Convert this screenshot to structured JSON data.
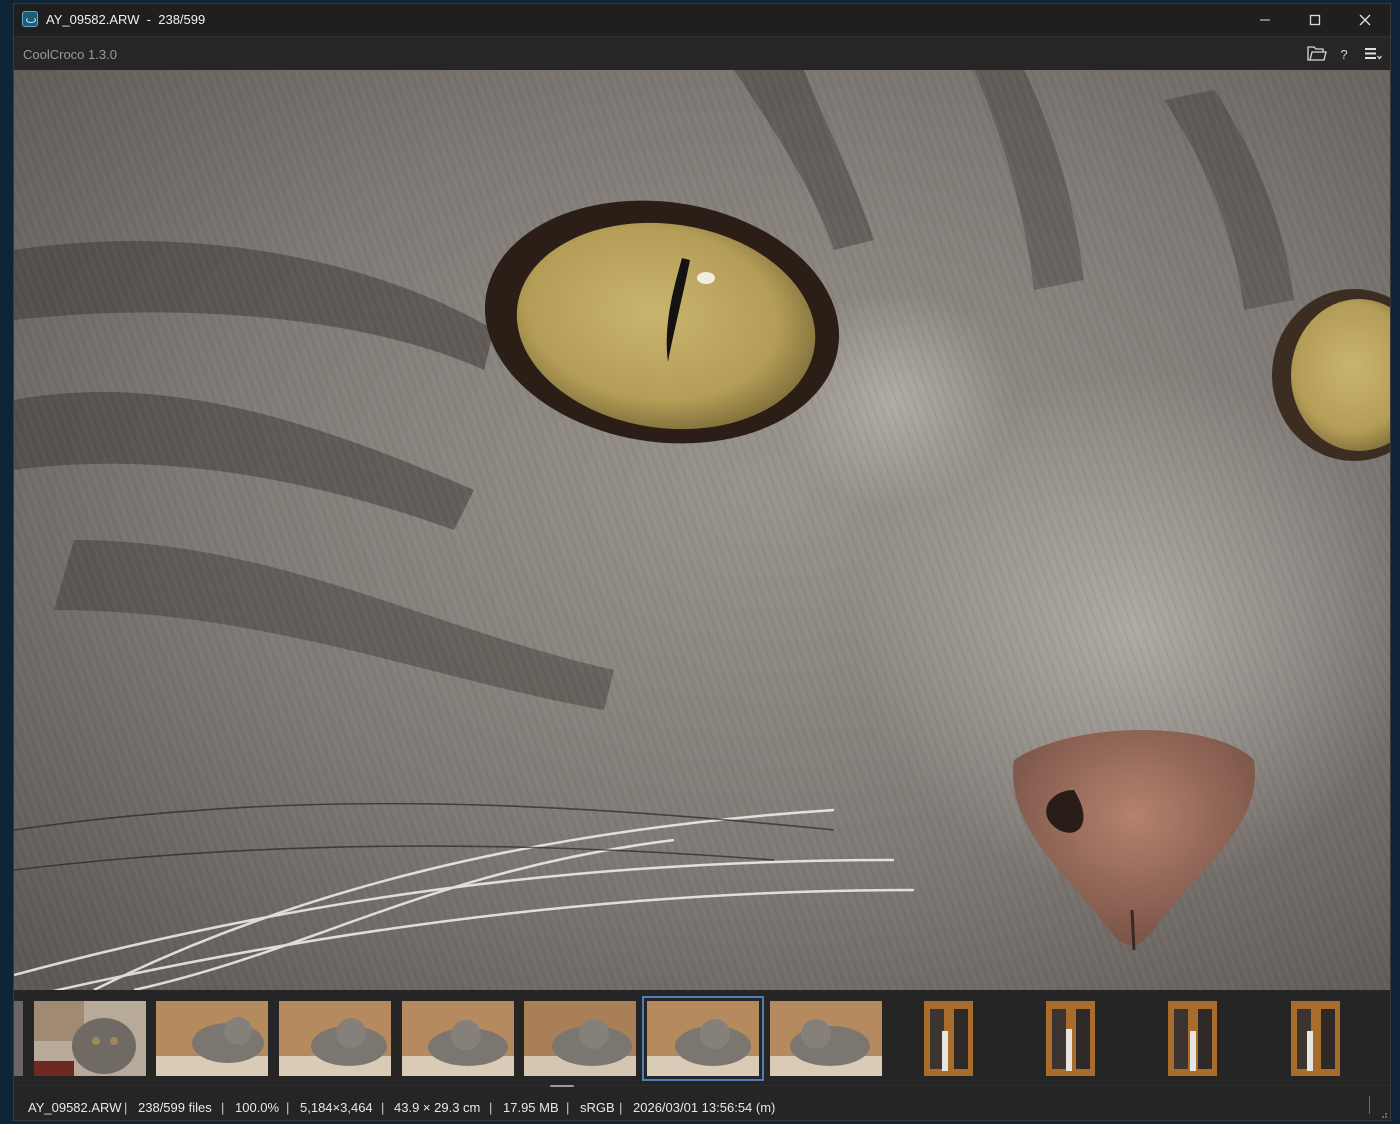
{
  "window": {
    "title": "AY_09582.ARW  -  238/599",
    "minimize_icon": "minimize-icon",
    "maximize_icon": "maximize-icon",
    "close_icon": "close-icon"
  },
  "toolbar": {
    "app_version": "CoolCroco 1.3.0",
    "open_folder_icon": "folder-icon",
    "help_label": "?",
    "menu_icon": "hamburger-menu-icon"
  },
  "viewer": {
    "image_alt": "AY_09582.ARW"
  },
  "filmstrip": {
    "selected_index": 5,
    "thumbnails": [
      "thumb-1",
      "thumb-2",
      "thumb-3",
      "thumb-4",
      "thumb-5",
      "thumb-6",
      "thumb-7",
      "thumb-8",
      "thumb-9",
      "thumb-10",
      "thumb-11"
    ]
  },
  "status": {
    "filename": "AY_09582.ARW",
    "file_position": "238/599 files",
    "zoom": "100.0%",
    "dimensions": "5,184×3,464",
    "print_size": "43.9 × 29.3 cm",
    "file_size": "17.95 MB",
    "color_space": "sRGB",
    "datetime": "2026/03/01 13:56:54 (m)",
    "separator": "|"
  },
  "colors": {
    "background": "#1e1e1e",
    "accent_selection": "#4f7fb5",
    "desktop": "#0f2436"
  }
}
